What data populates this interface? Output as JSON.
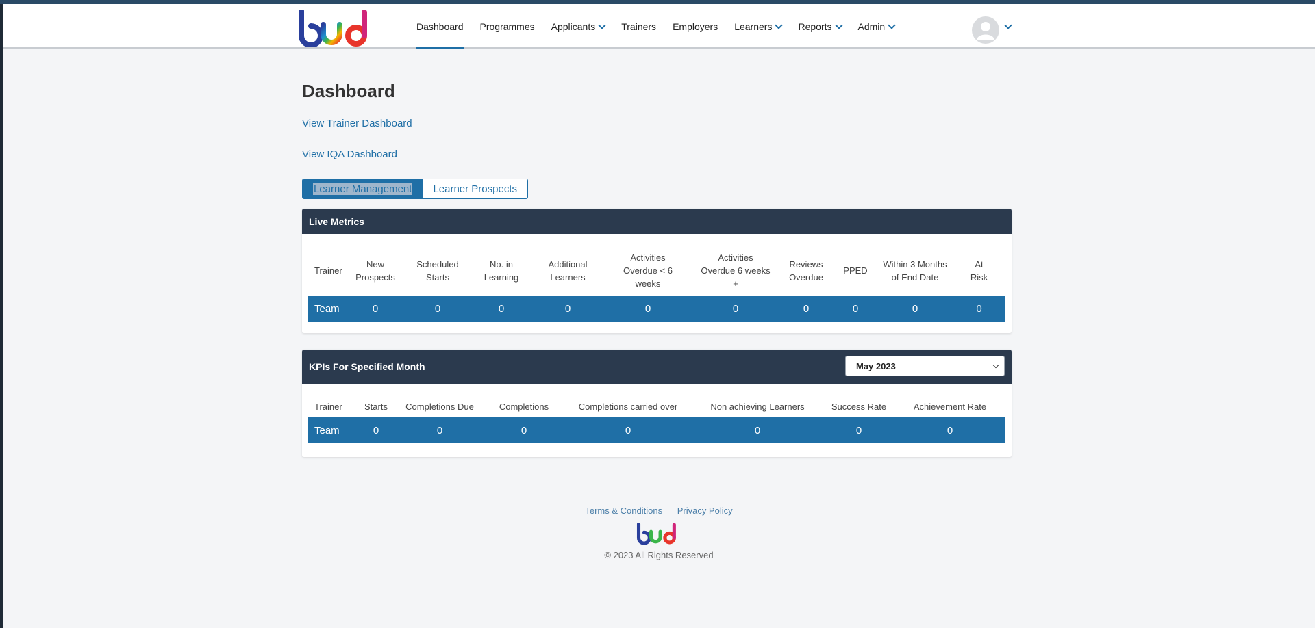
{
  "brand": {
    "logo_text": "bud"
  },
  "nav": {
    "items": [
      {
        "label": "Dashboard",
        "active": true,
        "dropdown": false
      },
      {
        "label": "Programmes",
        "active": false,
        "dropdown": false
      },
      {
        "label": "Applicants",
        "active": false,
        "dropdown": true
      },
      {
        "label": "Trainers",
        "active": false,
        "dropdown": false
      },
      {
        "label": "Employers",
        "active": false,
        "dropdown": false
      },
      {
        "label": "Learners",
        "active": false,
        "dropdown": true
      },
      {
        "label": "Reports",
        "active": false,
        "dropdown": true
      },
      {
        "label": "Admin",
        "active": false,
        "dropdown": true
      }
    ]
  },
  "page": {
    "title": "Dashboard",
    "links": {
      "trainer_dashboard": "View Trainer Dashboard",
      "iqa_dashboard": "View IQA Dashboard"
    },
    "toggle": {
      "learner_management": "Learner Management",
      "learner_prospects": "Learner Prospects"
    }
  },
  "live_metrics": {
    "title": "Live Metrics",
    "headers": [
      [
        "Trainer"
      ],
      [
        "New",
        "Prospects"
      ],
      [
        "Scheduled",
        "Starts"
      ],
      [
        "No. in",
        "Learning"
      ],
      [
        "Additional",
        "Learners"
      ],
      [
        "Activities",
        "Overdue < 6",
        "weeks"
      ],
      [
        "Activities",
        "Overdue 6 weeks",
        "+"
      ],
      [
        "Reviews",
        "Overdue"
      ],
      [
        "PPED"
      ],
      [
        "Within 3 Months",
        "of End Date"
      ],
      [
        "At",
        "Risk"
      ]
    ],
    "row": [
      "Team",
      "0",
      "0",
      "0",
      "0",
      "0",
      "0",
      "0",
      "0",
      "0",
      "0"
    ]
  },
  "kpis": {
    "title": "KPIs For Specified Month",
    "month_selected": "May 2023",
    "headers": [
      "Trainer",
      "Starts",
      "Completions Due",
      "Completions",
      "Completions carried over",
      "Non achieving Learners",
      "Success Rate",
      "Achievement Rate"
    ],
    "row": [
      "Team",
      "0",
      "0",
      "0",
      "0",
      "0",
      "0",
      "0"
    ]
  },
  "footer": {
    "terms": "Terms & Conditions",
    "privacy": "Privacy Policy",
    "copyright": "© 2023 All Rights Reserved"
  },
  "colors": {
    "primary": "#1f6fa6",
    "panel_header": "#2b3a4e",
    "background": "#f4f5f7"
  }
}
